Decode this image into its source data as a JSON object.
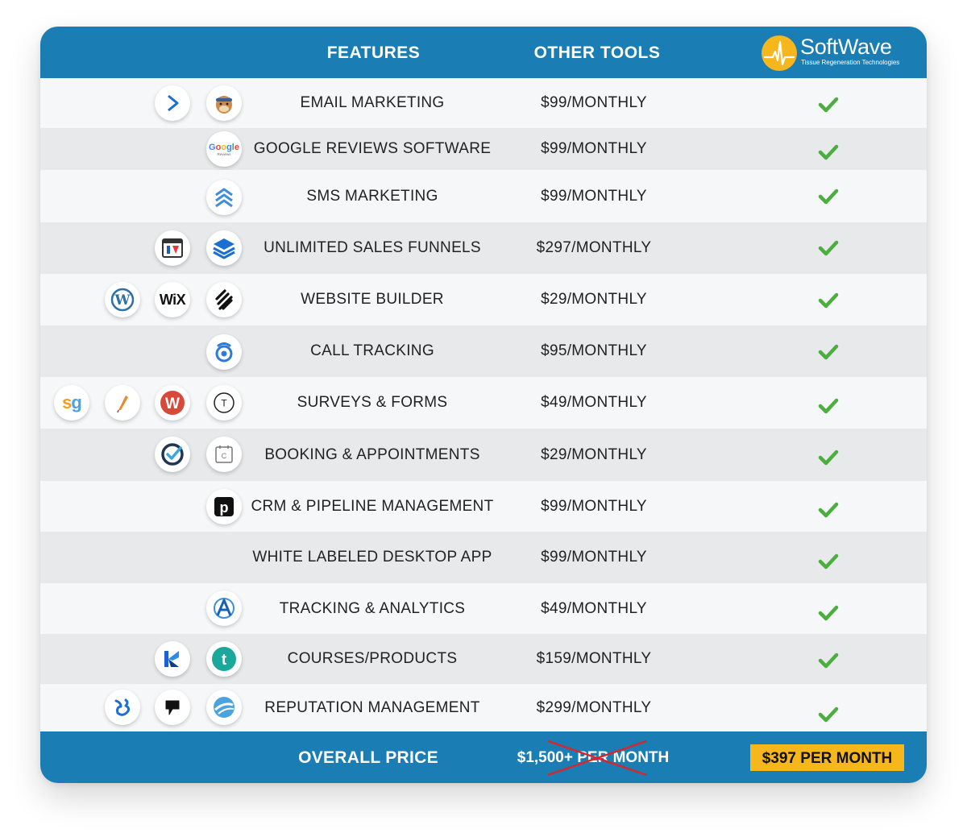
{
  "header": {
    "features_label": "FEATURES",
    "other_tools_label": "OTHER TOOLS",
    "logo_name": "SoftWave",
    "logo_tagline": "Tissue Regeneration Technologies"
  },
  "rows": [
    {
      "feature": "EMAIL MARKETING",
      "price": "$99/MONTHLY",
      "icons": [
        "activecampaign-icon",
        "mailchimp-icon"
      ],
      "included": true
    },
    {
      "feature": "GOOGLE REVIEWS SOFTWARE",
      "price": "$99/MONTHLY",
      "icons": [
        "google-reviews-icon"
      ],
      "included": true
    },
    {
      "feature": "SMS MARKETING",
      "price": "$99/MONTHLY",
      "icons": [
        "sms-chevrons-icon"
      ],
      "included": true
    },
    {
      "feature": "UNLIMITED SALES FUNNELS",
      "price": "$297/MONTHLY",
      "icons": [
        "clickfunnels-icon",
        "layers-icon"
      ],
      "included": true
    },
    {
      "feature": "WEBSITE BUILDER",
      "price": "$29/MONTHLY",
      "icons": [
        "wordpress-icon",
        "wix-icon",
        "squarespace-icon"
      ],
      "included": true
    },
    {
      "feature": "CALL TRACKING",
      "price": "$95/MONTHLY",
      "icons": [
        "callrail-icon"
      ],
      "included": true
    },
    {
      "feature": "SURVEYS & FORMS",
      "price": "$49/MONTHLY",
      "icons": [
        "surveygizmo-icon",
        "quill-icon",
        "wufoo-icon",
        "typeform-icon"
      ],
      "included": true
    },
    {
      "feature": "BOOKING & APPOINTMENTS",
      "price": "$29/MONTHLY",
      "icons": [
        "acuity-icon",
        "calendly-icon"
      ],
      "included": true
    },
    {
      "feature": "CRM & PIPELINE MANAGEMENT",
      "price": "$99/MONTHLY",
      "icons": [
        "pipedrive-icon"
      ],
      "included": true
    },
    {
      "feature": "WHITE LABELED DESKTOP APP",
      "price": "$99/MONTHLY",
      "icons": [],
      "included": true
    },
    {
      "feature": "TRACKING & ANALYTICS",
      "price": "$49/MONTHLY",
      "icons": [
        "analytics-icon"
      ],
      "included": true
    },
    {
      "feature": "COURSES/PRODUCTS",
      "price": "$159/MONTHLY",
      "icons": [
        "kajabi-icon",
        "teachable-icon"
      ],
      "included": true
    },
    {
      "feature": "REPUTATION MANAGEMENT",
      "price": "$299/MONTHLY",
      "icons": [
        "birdeye-icon",
        "podium-icon",
        "reputation-icon"
      ],
      "included": true
    }
  ],
  "footer": {
    "label": "OVERALL PRICE",
    "old_price": "$1,500+ PER MONTH",
    "new_price": "$397 PER MONTH"
  },
  "colors": {
    "header_blue": "#1a7db3",
    "accent_yellow": "#f5b71c",
    "check_green": "#4cae3e",
    "strike_red": "#d9262c"
  }
}
